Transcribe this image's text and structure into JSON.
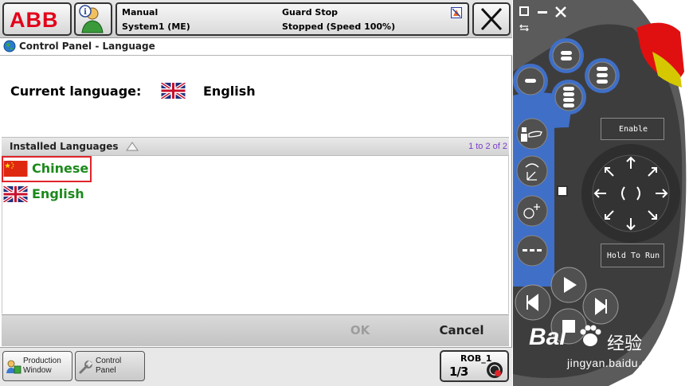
{
  "header": {
    "logo": "ABB",
    "mode": "Manual",
    "system": "System1 (ME)",
    "guard": "Guard Stop",
    "state": "Stopped (Speed 100%)"
  },
  "window": {
    "title": "Control Panel - Language"
  },
  "current": {
    "label": "Current language:",
    "value": "English"
  },
  "list": {
    "header": "Installed Languages",
    "count": "1 to 2 of 2",
    "items": [
      {
        "label": "Chinese",
        "flag": "flag-china-icon"
      },
      {
        "label": "English",
        "flag": "flag-uk-icon"
      }
    ]
  },
  "commands": {
    "ok": "OK",
    "cancel": "Cancel"
  },
  "taskbar": {
    "production_line1": "Production",
    "production_line2": "Window",
    "control_line1": "Control",
    "control_line2": "Panel",
    "rob": "ROB_1",
    "rob_fraction": "1/3"
  },
  "controller": {
    "enable": "Enable",
    "hold": "Hold To Run"
  },
  "watermark": {
    "brand": "Bai",
    "cn": "经验",
    "url": "jingyan.baidu.com"
  },
  "colors": {
    "abb_red": "#e2001a",
    "lang_green": "#1b8a1b",
    "highlight_red": "#e0242a",
    "count_purple": "#7a3ccc",
    "panel_blue": "#3f6fc7"
  }
}
